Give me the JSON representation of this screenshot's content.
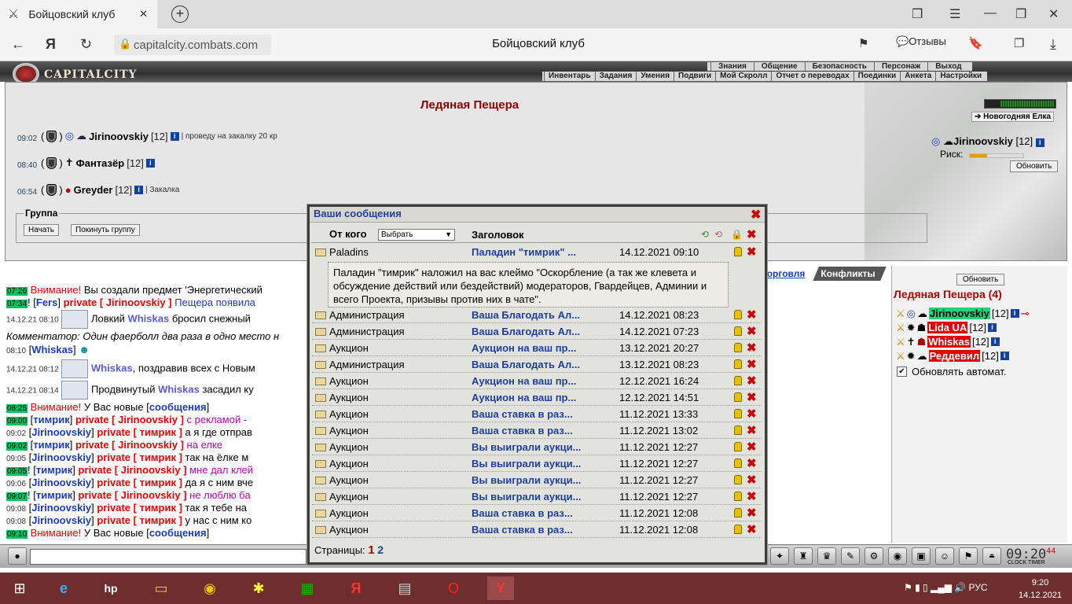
{
  "browser": {
    "tab_title": "Бойцовский клуб",
    "url": "capitalcity.combats.com",
    "page_title": "Бойцовский клуб",
    "reviews": "Отзывы"
  },
  "header": {
    "logo": "CAPITALCITY",
    "menu_top": [
      "Знания",
      "Общение",
      "Безопасность",
      "Персонаж",
      "Выход"
    ],
    "menu_sub": [
      "Инвентарь",
      "Задания",
      "Умения",
      "Подвиги",
      "Мой Скролл",
      "Отчет о переводах",
      "Поединки",
      "Анкета",
      "Настройки"
    ]
  },
  "location": {
    "title": "Ледяная Пещера",
    "players": [
      {
        "time": "09:02",
        "name": "Jirinoovskiy",
        "level": "[12]",
        "note": "| проведу на закалку 20 кр"
      },
      {
        "time": "08:40",
        "name": "Фантазёр",
        "level": "[12]",
        "note": ""
      },
      {
        "time": "06:54",
        "name": "Greyder",
        "level": "[12]",
        "note": "| Закалка"
      }
    ],
    "group_title": "Группа",
    "group_start": "Начать",
    "group_leave": "Покинуть группу"
  },
  "right_panel": {
    "event": "Новогодняя Елка",
    "player": "Jirinoovskiy",
    "level": "[12]",
    "risk": "Риск:",
    "refresh": "Обновить"
  },
  "chat_tabs": {
    "trade": "торговля",
    "conflicts": "Конфликты"
  },
  "online": {
    "refresh": "Обновить",
    "title": "Ледяная Пещера (4)",
    "users": [
      {
        "name": "Jirinoovskiy",
        "level": "[12]",
        "color": "#00d080"
      },
      {
        "name": "Lida UA",
        "level": "[12]",
        "color": "#e00000"
      },
      {
        "name": "Whiskas",
        "level": "[12]",
        "color": "#e00000"
      },
      {
        "name": "Реддевил",
        "level": "[12]",
        "color": "#e00000"
      }
    ],
    "auto_refresh": "Обновлять автомат."
  },
  "modal": {
    "title": "Ваши сообщения",
    "from_label": "От кого",
    "from_select": "Выбрать",
    "subject_label": "Заголовок",
    "expanded_text": "Паладин \"тимрик\" наложил на вас клеймо \"Оскорбление (а так же клевета и обсуждение действий или бездействий) модераторов, Гвардейцев, Админии и всего Проекта, призывы против них в чате\".",
    "messages": [
      {
        "from": "Paladins",
        "subject": "Паладин \"тимрик\" ...",
        "date": "14.12.2021 09:10"
      },
      {
        "from": "Администрация",
        "subject": "Ваша Благодать Ал...",
        "date": "14.12.2021 08:23"
      },
      {
        "from": "Администрация",
        "subject": "Ваша Благодать Ал...",
        "date": "14.12.2021 07:23"
      },
      {
        "from": "Аукцион",
        "subject": "Аукцион на ваш пр...",
        "date": "13.12.2021 20:27"
      },
      {
        "from": "Администрация",
        "subject": "Ваша Благодать Ал...",
        "date": "13.12.2021 08:23"
      },
      {
        "from": "Аукцион",
        "subject": "Аукцион на ваш пр...",
        "date": "12.12.2021 16:24"
      },
      {
        "from": "Аукцион",
        "subject": "Аукцион на ваш пр...",
        "date": "12.12.2021 14:51"
      },
      {
        "from": "Аукцион",
        "subject": "Ваша ставка в раз...",
        "date": "11.12.2021 13:33"
      },
      {
        "from": "Аукцион",
        "subject": "Ваша ставка в раз...",
        "date": "11.12.2021 13:02"
      },
      {
        "from": "Аукцион",
        "subject": "Вы выиграли аукци...",
        "date": "11.12.2021 12:27"
      },
      {
        "from": "Аукцион",
        "subject": "Вы выиграли аукци...",
        "date": "11.12.2021 12:27"
      },
      {
        "from": "Аукцион",
        "subject": "Вы выиграли аукци...",
        "date": "11.12.2021 12:27"
      },
      {
        "from": "Аукцион",
        "subject": "Вы выиграли аукци...",
        "date": "11.12.2021 12:27"
      },
      {
        "from": "Аукцион",
        "subject": "Ваша ставка в раз...",
        "date": "11.12.2021 12:08"
      },
      {
        "from": "Аукцион",
        "subject": "Ваша ставка в раз...",
        "date": "11.12.2021 12:08"
      }
    ],
    "pages_label": "Страницы:",
    "page_current": "1",
    "page_next": "2"
  },
  "chat": {
    "l1": {
      "t": "07:26",
      "a": "Внимание!",
      "b": " Вы создали предмет 'Энергетический"
    },
    "l2": {
      "t": "07:34",
      "a": "! [",
      "b": "Fers",
      "c": "] ",
      "d": "private [ Jirinoovskiy ]",
      "e": " Пещера появила"
    },
    "l3": {
      "t": "14.12.21 08:10",
      "b": " Ловкий ",
      "c": "Whiskas",
      "d": " бросил снежный"
    },
    "l4": {
      "a": "Комментатор: Один фаерболл два раза в одно место н"
    },
    "l5": {
      "t": "08:10",
      "a": "[",
      "b": "Whiskas",
      "c": "]"
    },
    "l6": {
      "t": "14.12.21 08:12",
      "c": "Whiskas",
      "d": ", поздравив всех с Новым"
    },
    "l7": {
      "t": "14.12.21 08:14",
      "b": " Продвинутый ",
      "c": "Whiskas",
      "d": " засадил ку"
    },
    "l8": {
      "t": "08:25",
      "a": "Внимание!",
      "b": " У Вас новые [",
      "c": "сообщения",
      "d": "]"
    },
    "l9": {
      "t": "09:00",
      "a": "[",
      "b": "тимрик",
      "c": "] ",
      "d": "private [ Jirinoovskiy ]",
      "e": " с рекламой -"
    },
    "l10": {
      "t": "09:02",
      "a": "[",
      "b": "Jirinoovskiy",
      "c": "] ",
      "d": "private [ тимрик ]",
      "e": " а я где отправ"
    },
    "l11": {
      "t": "09:02",
      "a": "[",
      "b": "тимрик",
      "c": "] ",
      "d": "private [ Jirinoovskiy ]",
      "e": " на елке"
    },
    "l12": {
      "t": "09:05",
      "a": "[",
      "b": "Jirinoovskiy",
      "c": "] ",
      "d": "private [ тимрик ]",
      "e": " так на ёлке м"
    },
    "l13": {
      "t": "09:05",
      "a": "! [",
      "b": "тимрик",
      "c": "] ",
      "d": "private [ Jirinoovskiy ]",
      "e": " мне дал клей"
    },
    "l14": {
      "t": "09:06",
      "a": "[",
      "b": "Jirinoovskiy",
      "c": "] ",
      "d": "private [ тимрик ]",
      "e": " да я с ним вче"
    },
    "l15": {
      "t": "09:07",
      "a": "! [",
      "b": "тимрик",
      "c": "] ",
      "d": "private [ Jirinoovskiy ]",
      "e": " не люблю ба"
    },
    "l16": {
      "t": "09:08",
      "a": "[",
      "b": "Jirinoovskiy",
      "c": "] ",
      "d": "private [ тимрик ]",
      "e": " так я тебе на"
    },
    "l17": {
      "t": "09:08",
      "a": "[",
      "b": "Jirinoovskiy",
      "c": "] ",
      "d": "private [ тимрик ]",
      "e": " у нас с ним ко"
    },
    "l18": {
      "t": "09:10",
      "a": "Внимание!",
      "b": " У Вас новые [",
      "c": "сообщения",
      "d": "]"
    }
  },
  "clock": {
    "time": "09:20",
    "sec": "44",
    "labels": "CLOCK TIMER"
  },
  "taskbar": {
    "lang": "РУС",
    "time": "9:20",
    "date": "14.12.2021"
  }
}
